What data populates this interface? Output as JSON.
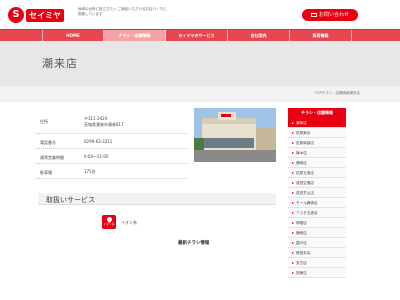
{
  "header": {
    "logo_mark": "S",
    "logo_text": "セイミヤ",
    "tagline": "地域の台所に役立ちたい ご満足いただけるお店づくりに挑戦しています",
    "contact_label": "お問い合わせ",
    "colors": {
      "brand": "#e60012",
      "nav": "#e4474f"
    }
  },
  "nav": {
    "items": [
      {
        "label": "HOME",
        "active": false
      },
      {
        "label": "チラシ・店舗情報",
        "active": true
      },
      {
        "label": "セイミヤのサービス",
        "active": false
      },
      {
        "label": "会社案内",
        "active": false
      },
      {
        "label": "採用情報",
        "active": false
      }
    ]
  },
  "page": {
    "title": "潮来店",
    "breadcrumb": "TOPチラシ・店舗情報潮来店"
  },
  "store_info": {
    "rows": [
      {
        "label": "住所",
        "value_line1": "〒311-2424",
        "value_line2": "茨城県潮来市潮来817"
      },
      {
        "label": "電話番号",
        "value_line1": "0299-63-3211",
        "value_line2": ""
      },
      {
        "label": "通常営業時間",
        "value_line1": "9:00～21:00",
        "value_line2": ""
      },
      {
        "label": "駐車場",
        "value_line1": "175台",
        "value_line2": ""
      }
    ]
  },
  "services": {
    "title": "取扱いサービス",
    "icon_name": "waon-icon",
    "icon_caption": "イオン系",
    "item_label": "イオン系",
    "latest_flyer": "最新チラシ情報"
  },
  "sidebar": {
    "heading": "チラシ・店舗情報",
    "items": [
      {
        "label": "潮来店",
        "active": true
      },
      {
        "label": "佐原東店",
        "active": false
      },
      {
        "label": "佐原南部店",
        "active": false
      },
      {
        "label": "篠木店",
        "active": false
      },
      {
        "label": "鹿嶋店",
        "active": false
      },
      {
        "label": "佐原玉造店",
        "active": false
      },
      {
        "label": "成田空港店",
        "active": false
      },
      {
        "label": "成田芝山店",
        "active": false
      },
      {
        "label": "モール鹿嶋店",
        "active": false
      },
      {
        "label": "アスタ玉造店",
        "active": false
      },
      {
        "label": "神栖店",
        "active": false
      },
      {
        "label": "鹿嶋店",
        "active": false
      },
      {
        "label": "嬉戸店",
        "active": false
      },
      {
        "label": "鉾田本店",
        "active": false
      },
      {
        "label": "多古店",
        "active": false
      },
      {
        "label": "旭東店",
        "active": false
      }
    ]
  }
}
